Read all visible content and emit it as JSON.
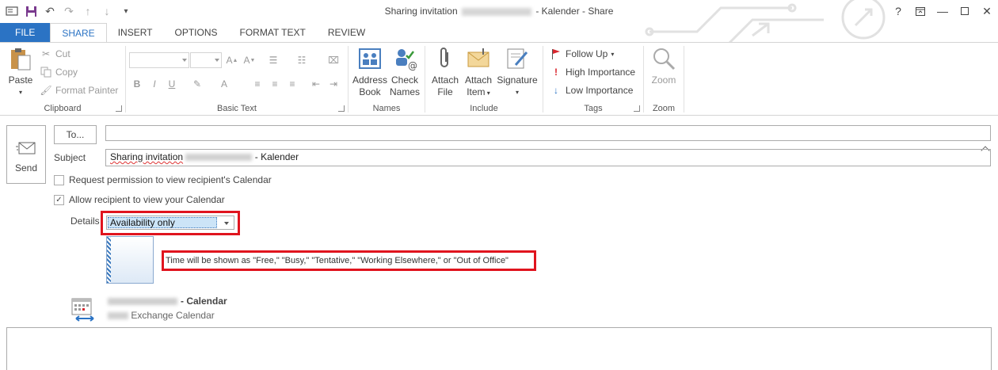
{
  "window": {
    "title_prefix": "Sharing invitation",
    "title_suffix": "- Kalender - Share",
    "help": "?",
    "minimize": "—",
    "close": "✕"
  },
  "tabs": [
    {
      "label": "FILE"
    },
    {
      "label": "SHARE"
    },
    {
      "label": "INSERT"
    },
    {
      "label": "OPTIONS"
    },
    {
      "label": "FORMAT TEXT"
    },
    {
      "label": "REVIEW"
    }
  ],
  "ribbon": {
    "clipboard": {
      "label": "Clipboard",
      "paste": "Paste",
      "cut": "Cut",
      "copy": "Copy",
      "format_painter": "Format Painter"
    },
    "basic_text": {
      "label": "Basic Text"
    },
    "names": {
      "label": "Names",
      "address_book_1": "Address",
      "address_book_2": "Book",
      "check_names_1": "Check",
      "check_names_2": "Names"
    },
    "include": {
      "label": "Include",
      "attach_file_1": "Attach",
      "attach_file_2": "File",
      "attach_item_1": "Attach",
      "attach_item_2": "Item",
      "signature": "Signature"
    },
    "tags": {
      "label": "Tags",
      "follow_up": "Follow Up",
      "high_importance": "High Importance",
      "low_importance": "Low Importance"
    },
    "zoom": {
      "label": "Zoom",
      "zoom": "Zoom"
    }
  },
  "compose": {
    "send": "Send",
    "to": "To...",
    "to_value": "",
    "subject_label": "Subject",
    "subject_word": "Sharing invitation",
    "subject_suffix": " - Kalender",
    "request_permission": "Request permission to view recipient's Calendar",
    "allow_recipient": "Allow recipient to view your Calendar",
    "allow_checked": "✓",
    "details_label": "Details",
    "details_value": "Availability only",
    "details_desc": "Time will be shown as \"Free,\" \"Busy,\" \"Tentative,\" \"Working Elsewhere,\" or \"Out of Office\"",
    "calendar_name": "- Calendar",
    "calendar_type": "Exchange Calendar"
  },
  "colors": {
    "accent": "#2b73c4",
    "highlight_box": "#e0141e"
  }
}
